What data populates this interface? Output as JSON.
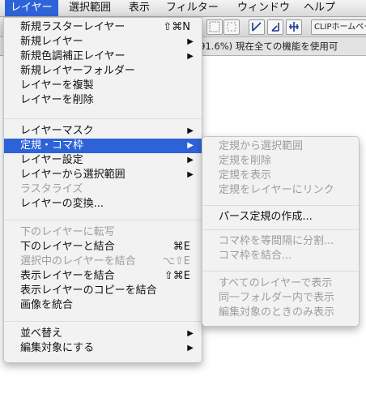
{
  "menubar": [
    "レイヤー",
    "選択範囲",
    "表示",
    "フィルター",
    "ウィンドウ",
    "ヘルプ"
  ],
  "toolbar": {
    "clip_label": "CLIPホームペー"
  },
  "infobar": {
    "text": "pi 91.6%) 現在全ての機能を使用可"
  },
  "main_menu": [
    {
      "label": "新規ラスターレイヤー",
      "shortcut": "⇧⌘N"
    },
    {
      "label": "新規レイヤー",
      "submenu": "▶"
    },
    {
      "label": "新規色調補正レイヤー",
      "submenu": "▶"
    },
    {
      "label": "新規レイヤーフォルダー"
    },
    {
      "label": "レイヤーを複製"
    },
    {
      "label": "レイヤーを削除"
    },
    {
      "label": "レイヤーマスク",
      "submenu": "▶"
    },
    {
      "label": "定規・コマ枠",
      "submenu": "▶",
      "highlighted": true
    },
    {
      "label": "レイヤー設定",
      "submenu": "▶"
    },
    {
      "label": "レイヤーから選択範囲",
      "submenu": "▶"
    },
    {
      "label": "ラスタライズ",
      "disabled": true
    },
    {
      "label": "レイヤーの変換..."
    },
    {
      "label": "下のレイヤーに転写",
      "disabled": true
    },
    {
      "label": "下のレイヤーと結合",
      "shortcut": "⌘E"
    },
    {
      "label": "選択中のレイヤーを結合",
      "shortcut": "⌥⇧E",
      "disabled": true
    },
    {
      "label": "表示レイヤーを結合",
      "shortcut": "⇧⌘E"
    },
    {
      "label": "表示レイヤーのコピーを結合"
    },
    {
      "label": "画像を統合"
    },
    {
      "label": "並べ替え",
      "submenu": "▶"
    },
    {
      "label": "編集対象にする",
      "submenu": "▶"
    }
  ],
  "sub_menu": [
    {
      "label": "定規から選択範囲",
      "disabled": true
    },
    {
      "label": "定規を削除",
      "disabled": true
    },
    {
      "label": "定規を表示",
      "disabled": true
    },
    {
      "label": "定規をレイヤーにリンク",
      "disabled": true
    },
    {
      "label": "パース定規の作成..."
    },
    {
      "label": "コマ枠を等間隔に分割...",
      "disabled": true
    },
    {
      "label": "コマ枠を結合...",
      "disabled": true
    },
    {
      "label": "すべてのレイヤーで表示",
      "disabled": true
    },
    {
      "label": "同一フォルダー内で表示",
      "disabled": true
    },
    {
      "label": "編集対象のときのみ表示",
      "disabled": true
    }
  ],
  "icons": [
    "ruler-corner-icon",
    "ruler-link-icon",
    "symmetric-ruler-icon"
  ],
  "colors": {
    "highlight": "#2e63d8"
  }
}
